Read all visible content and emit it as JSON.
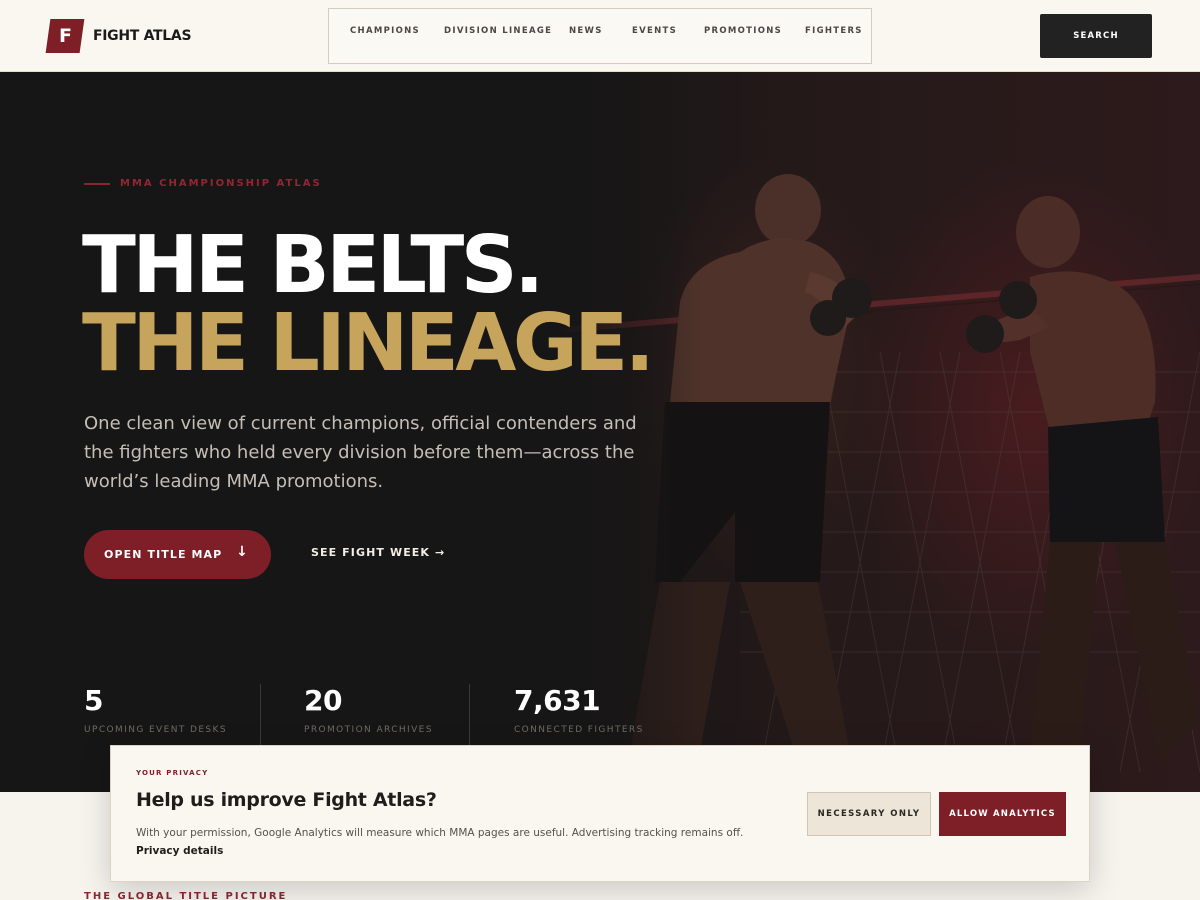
{
  "header": {
    "logo_letter": "F",
    "logo_text": "FIGHT ATLAS",
    "nav": [
      "CHAMPIONS",
      "DIVISION LINEAGE",
      "NEWS",
      "EVENTS",
      "PROMOTIONS",
      "FIGHTERS"
    ],
    "search_label": "SEARCH"
  },
  "hero": {
    "eyebrow": "MMA CHAMPIONSHIP ATLAS",
    "headline_line1": "THE BELTS.",
    "headline_line2": "THE LINEAGE.",
    "lead": "One clean view of current champions, official contenders and the fighters who held every division before them—across the world’s leading MMA promotions.",
    "cta_primary": "OPEN TITLE MAP",
    "cta_primary_icon": "↓",
    "cta_secondary": "SEE FIGHT WEEK →",
    "stats": [
      {
        "value": "5",
        "label": "UPCOMING EVENT DESKS"
      },
      {
        "value": "20",
        "label": "PROMOTION ARCHIVES"
      },
      {
        "value": "7,631",
        "label": "CONNECTED FIGHTERS"
      }
    ]
  },
  "below": {
    "section_label": "THE GLOBAL TITLE PICTURE"
  },
  "consent": {
    "eyebrow": "YOUR PRIVACY",
    "title": "Help us improve Fight Atlas?",
    "body": "With your permission, Google Analytics will measure which MMA pages are useful. Advertising tracking remains off.",
    "link": "Privacy details",
    "btn_necessary": "NECESSARY ONLY",
    "btn_allow": "ALLOW ANALYTICS"
  },
  "colors": {
    "brand": "#7e1f28",
    "gold": "#c6a45c",
    "hero_bg": "#171616",
    "cream": "#faf7f0"
  }
}
